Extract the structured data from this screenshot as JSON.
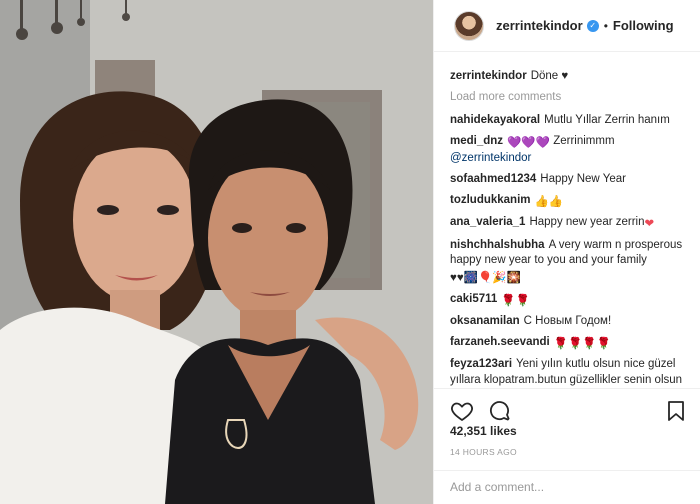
{
  "post": {
    "author": "zerrintekindor",
    "separator": "•",
    "follow_label": "Following",
    "verified_mark": "✓",
    "caption_user": "zerrintekindor",
    "caption_text": "Döne ♥",
    "load_more": "Load more comments",
    "likes": "42,351 likes",
    "time": "14 HOURS AGO",
    "comment_placeholder": "Add a comment..."
  },
  "comments": [
    {
      "user": "nahidekayakoral",
      "text": "Mutlu Yıllar Zerrin hanım"
    },
    {
      "user": "medi_dnz",
      "emoji": "💜💜💜",
      "text": "Zerrinimmm",
      "mention": "@zerrintekindor"
    },
    {
      "user": "sofaahmed1234",
      "text": "Happy New Year"
    },
    {
      "user": "tozludukkanim",
      "emoji": "👍👍"
    },
    {
      "user": "ana_valeria_1",
      "text": "Happy new year zerrin",
      "emoji": "❤"
    },
    {
      "user": "nishchhalshubha",
      "text": "A very warm n prosperous happy new year to you and your family",
      "emoji": "♥♥🎆🎈🎉🎇"
    },
    {
      "user": "caki5711",
      "emoji": "🌹🌹"
    },
    {
      "user": "oksanamilan",
      "text": "С Новым Годом!"
    },
    {
      "user": "farzaneh.seevandi",
      "emoji": "🌹🌹🌹🌹"
    },
    {
      "user": "feyza123ari",
      "text": "Yeni yılın kutlu olsun nice güzel yıllara klopatram.butun güzellikler senin olsun koçaman öpüyorum",
      "emoji": "😍😍😍😍😍😍"
    }
  ],
  "icons": {
    "like": "heart-icon",
    "comment": "comment-icon",
    "save": "bookmark-icon"
  }
}
